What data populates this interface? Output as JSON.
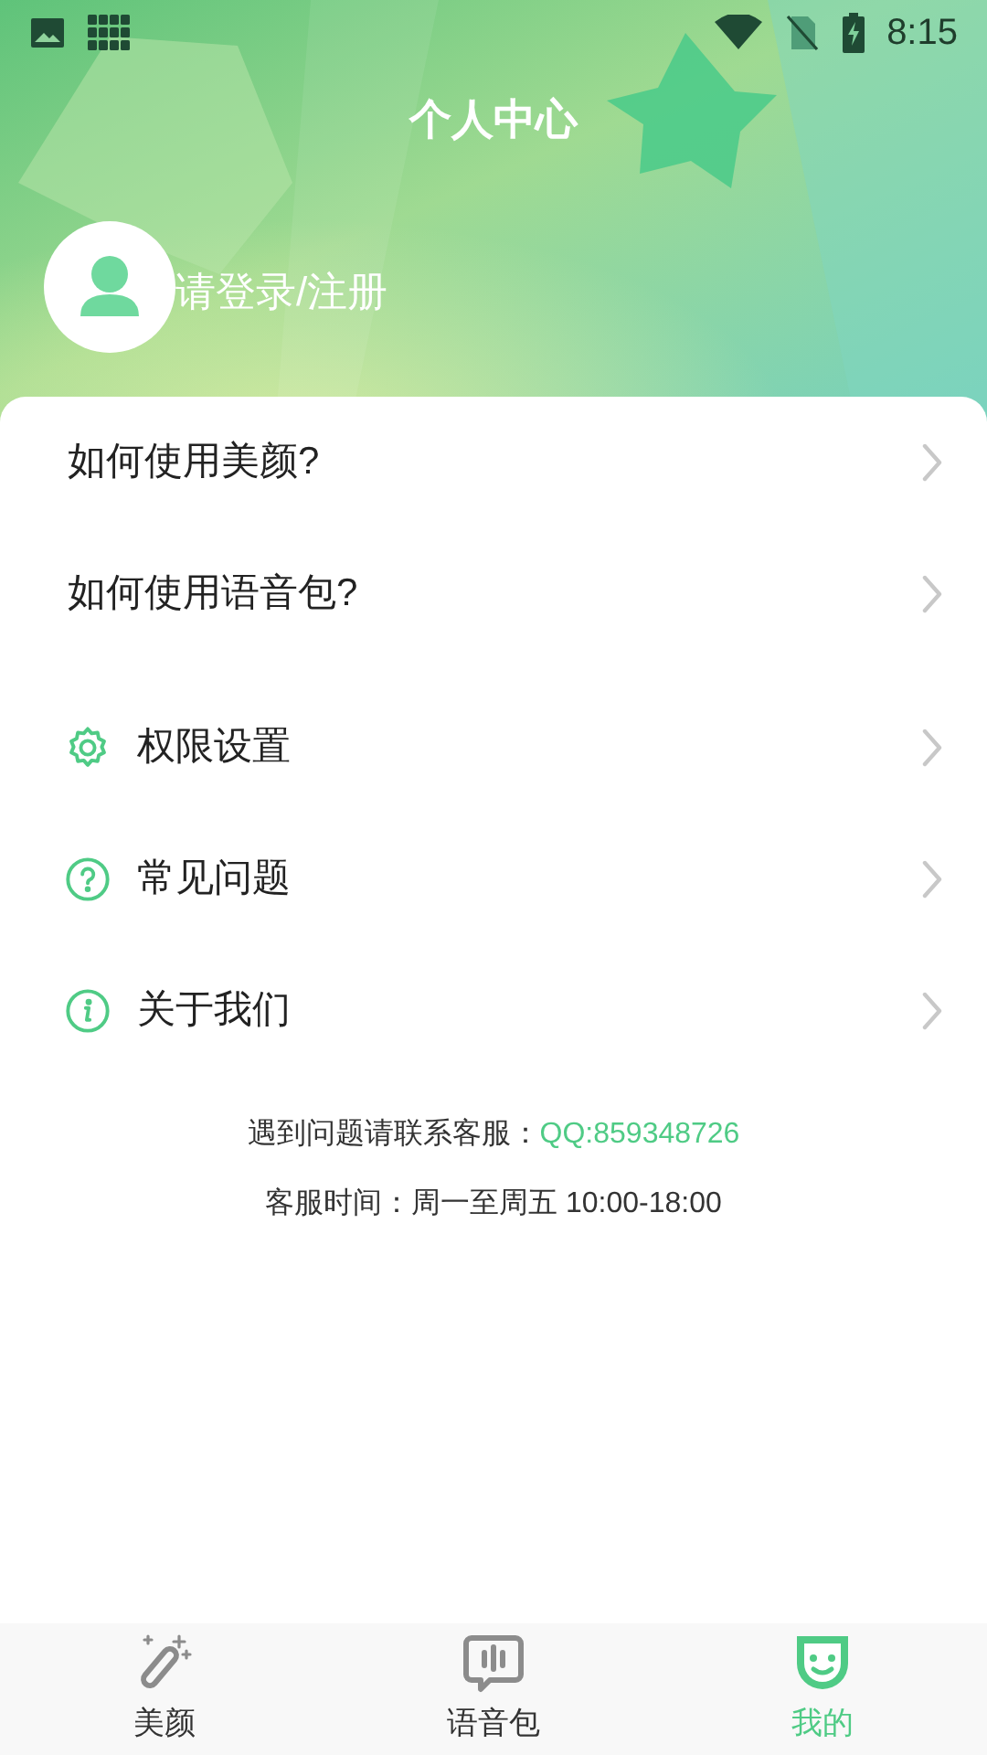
{
  "status_bar": {
    "time": "8:15"
  },
  "header": {
    "title": "个人中心",
    "login_text": "请登录/注册"
  },
  "help_links": [
    {
      "label": "如何使用美颜?"
    },
    {
      "label": "如何使用语音包?"
    }
  ],
  "settings_items": [
    {
      "label": "权限设置"
    },
    {
      "label": "常见问题"
    },
    {
      "label": "关于我们"
    }
  ],
  "contact": {
    "prefix": "遇到问题请联系客服：",
    "qq": "QQ:859348726",
    "hours": "客服时间：周一至周五 10:00-18:00"
  },
  "tabs": [
    {
      "label": "美颜",
      "selected": false
    },
    {
      "label": "语音包",
      "selected": false
    },
    {
      "label": "我的",
      "selected": true
    }
  ]
}
